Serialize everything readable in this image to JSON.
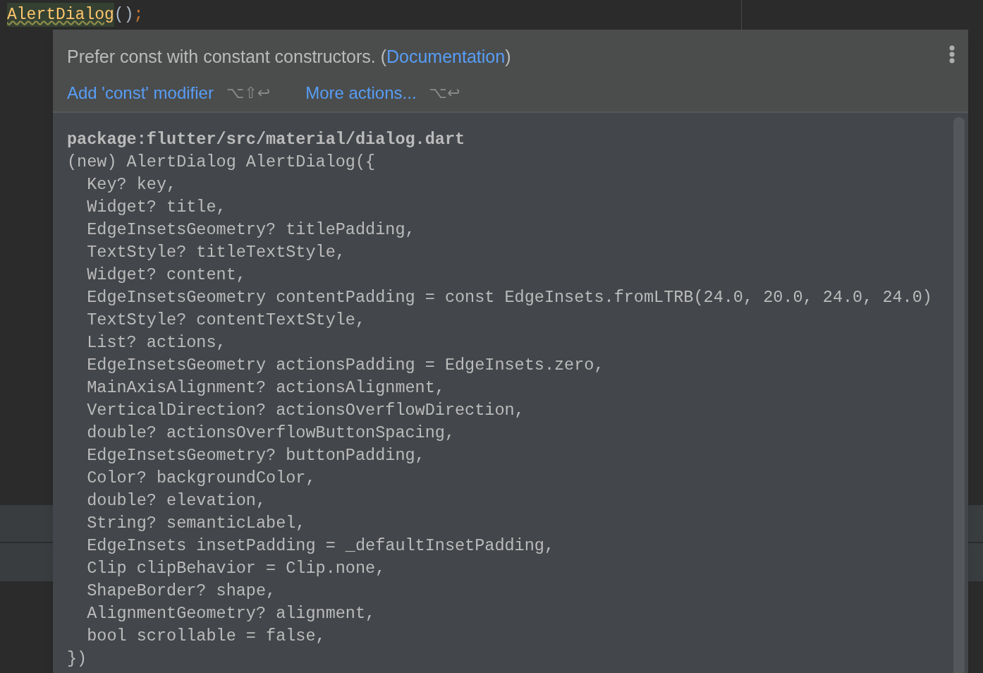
{
  "editor": {
    "tokens": [
      {
        "text": "AlertDialog",
        "kind": "class"
      },
      {
        "text": "()",
        "kind": "paren"
      },
      {
        "text": ";",
        "kind": "semicolon"
      }
    ]
  },
  "popup": {
    "message": "Prefer const with constant constructors. (",
    "link": "Documentation",
    "message_end": ")",
    "actions": [
      {
        "label": "Add 'const' modifier",
        "shortcut": "⌥⇧↩"
      },
      {
        "label": "More actions...",
        "shortcut": "⌥↩"
      }
    ],
    "doc": {
      "path": "package:flutter/src/material/dialog.dart",
      "lines": [
        "(new) AlertDialog AlertDialog({",
        "  Key? key,",
        "  Widget? title,",
        "  EdgeInsetsGeometry? titlePadding,",
        "  TextStyle? titleTextStyle,",
        "  Widget? content,",
        "  EdgeInsetsGeometry contentPadding = const EdgeInsets.fromLTRB(24.0, 20.0, 24.0, 24.0)",
        "  TextStyle? contentTextStyle,",
        "  List? actions,",
        "  EdgeInsetsGeometry actionsPadding = EdgeInsets.zero,",
        "  MainAxisAlignment? actionsAlignment,",
        "  VerticalDirection? actionsOverflowDirection,",
        "  double? actionsOverflowButtonSpacing,",
        "  EdgeInsetsGeometry? buttonPadding,",
        "  Color? backgroundColor,",
        "  double? elevation,",
        "  String? semanticLabel,",
        "  EdgeInsets insetPadding = _defaultInsetPadding,",
        "  Clip clipBehavior = Clip.none,",
        "  ShapeBorder? shape,",
        "  AlignmentGeometry? alignment,",
        "  bool scrollable = false,",
        "})"
      ]
    }
  }
}
